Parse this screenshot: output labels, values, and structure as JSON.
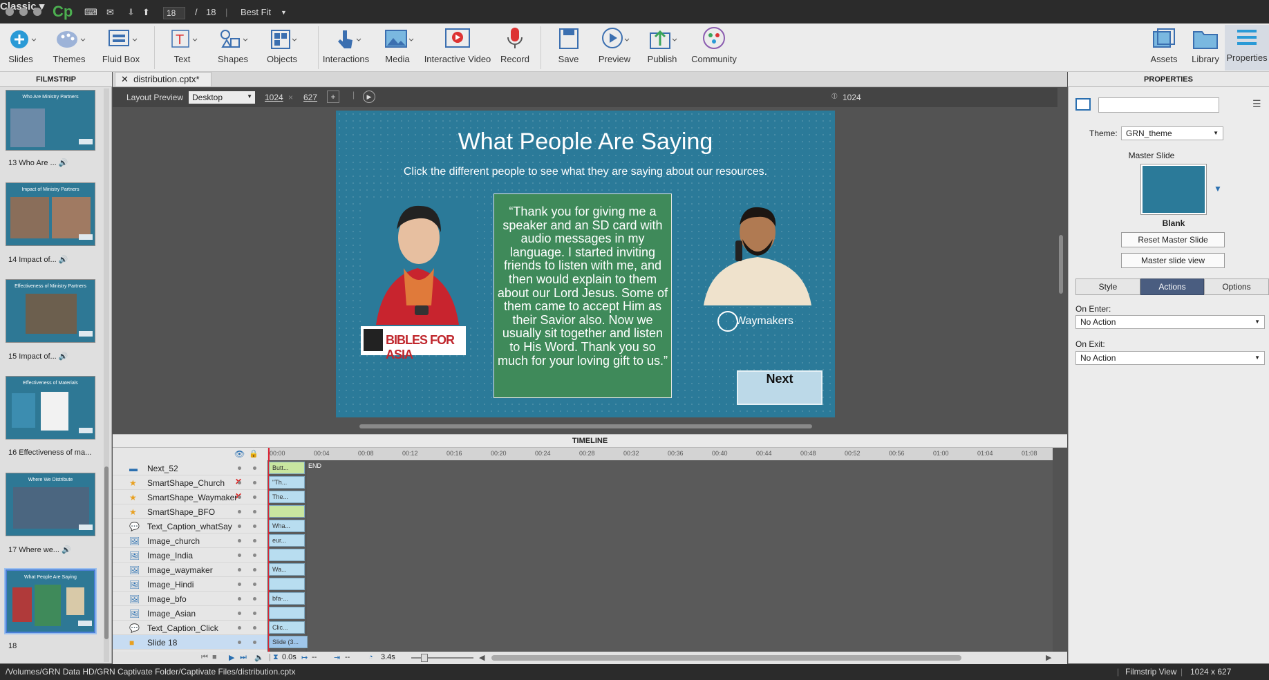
{
  "topbar": {
    "page_current": "18",
    "page_sep": "/",
    "page_total": "18",
    "zoom": "Best Fit",
    "mode": "Classic"
  },
  "toolbar": {
    "slides": "Slides",
    "themes": "Themes",
    "fluid_box": "Fluid Box",
    "text": "Text",
    "shapes": "Shapes",
    "objects": "Objects",
    "interactions": "Interactions",
    "media": "Media",
    "interactive_video": "Interactive Video",
    "record": "Record",
    "save": "Save",
    "preview": "Preview",
    "publish": "Publish",
    "community": "Community",
    "assets": "Assets",
    "library": "Library",
    "properties": "Properties"
  },
  "filmstrip": {
    "title": "FILMSTRIP",
    "items": [
      {
        "label": "13 Who Are ...",
        "thumb_title": "Who Are Ministry Partners"
      },
      {
        "label": "14 Impact of...",
        "thumb_title": "Impact of Ministry Partners"
      },
      {
        "label": "15 Impact of...",
        "thumb_title": "Effectiveness of Ministry Partners"
      },
      {
        "label": "16 Effectiveness of ma...",
        "thumb_title": "Effectiveness of Materials"
      },
      {
        "label": "17 Where we...",
        "thumb_title": "Where We Distribute"
      },
      {
        "label": "18",
        "thumb_title": "What People Are Saying"
      }
    ]
  },
  "doc": {
    "tab": "distribution.cptx*"
  },
  "layout_preview": {
    "label": "Layout Preview",
    "device": "Desktop",
    "width": "1024",
    "height": "627",
    "ruler_value": "1024"
  },
  "slide": {
    "title": "What People Are Saying",
    "subtitle": "Click the different people to see what they are saying about our resources.",
    "quote": "“Thank you for giving me a speaker and an SD card with audio messages in my language. I started inviting friends to listen with me, and then would explain to them about our Lord Jesus. Some of them came to accept Him as their Savior also. Now we usually sit together and listen to His Word. Thank you so much for your loving gift to us.”",
    "logo_bibles": "BIBLES FOR ASIA",
    "logo_waymakers": "Waymakers",
    "next": "Next"
  },
  "timeline": {
    "title": "TIMELINE",
    "ruler": [
      "00:00",
      "00:04",
      "00:08",
      "00:12",
      "00:16",
      "00:20",
      "00:24",
      "00:28",
      "00:32",
      "00:36",
      "00:40",
      "00:44",
      "00:48",
      "00:52",
      "00:56",
      "01:00",
      "01:04",
      "01:08"
    ],
    "end_label": "END",
    "rows": [
      {
        "name": "Next_52",
        "icon": "button-icon",
        "bar": "Butt...",
        "x": false
      },
      {
        "name": "SmartShape_Church",
        "icon": "star-icon",
        "bar": "\"Th...",
        "x": true
      },
      {
        "name": "SmartShape_Waymaker",
        "icon": "star-icon",
        "bar": "The...",
        "x": true
      },
      {
        "name": "SmartShape_BFO",
        "icon": "star-icon",
        "bar": "",
        "x": false
      },
      {
        "name": "Text_Caption_whatSay",
        "icon": "caption-icon",
        "bar": "Wha...",
        "x": false
      },
      {
        "name": "Image_church",
        "icon": "image-icon",
        "bar": "eur...",
        "x": false
      },
      {
        "name": "Image_India",
        "icon": "image-icon",
        "bar": "",
        "x": false
      },
      {
        "name": "Image_waymaker",
        "icon": "image-icon",
        "bar": "Wa...",
        "x": false
      },
      {
        "name": "Image_Hindi",
        "icon": "image-icon",
        "bar": "",
        "x": false
      },
      {
        "name": "Image_bfo",
        "icon": "image-icon",
        "bar": "bfa-...",
        "x": false
      },
      {
        "name": "Image_Asian",
        "icon": "image-icon",
        "bar": "",
        "x": false
      },
      {
        "name": "Text_Caption_Click",
        "icon": "caption-icon",
        "bar": "Clic...",
        "x": false
      },
      {
        "name": "Slide 18",
        "icon": "slide-icon",
        "bar": "Slide (3...",
        "x": false
      }
    ],
    "ctrl": {
      "time": "0.0s",
      "t2": "--",
      "t3": "--",
      "duration": "3.4s"
    }
  },
  "properties": {
    "title": "PROPERTIES",
    "theme_label": "Theme:",
    "theme_value": "GRN_theme",
    "master_slide_label": "Master Slide",
    "master_name": "Blank",
    "reset_master": "Reset Master Slide",
    "master_view": "Master slide view",
    "tabs": [
      "Style",
      "Actions",
      "Options"
    ],
    "on_enter_label": "On Enter:",
    "on_enter_value": "No Action",
    "on_exit_label": "On Exit:",
    "on_exit_value": "No Action"
  },
  "status": {
    "path": "/Volumes/GRN Data HD/GRN Captivate Folder/Captivate Files/distribution.cptx",
    "view": "Filmstrip View",
    "size": "1024 x 627"
  },
  "colors": {
    "slide_bg": "#2b7a99",
    "quote_bg": "#3f8a5a",
    "timeline_bar": "#b8ddf0",
    "active_tab": "#4a5d80"
  }
}
